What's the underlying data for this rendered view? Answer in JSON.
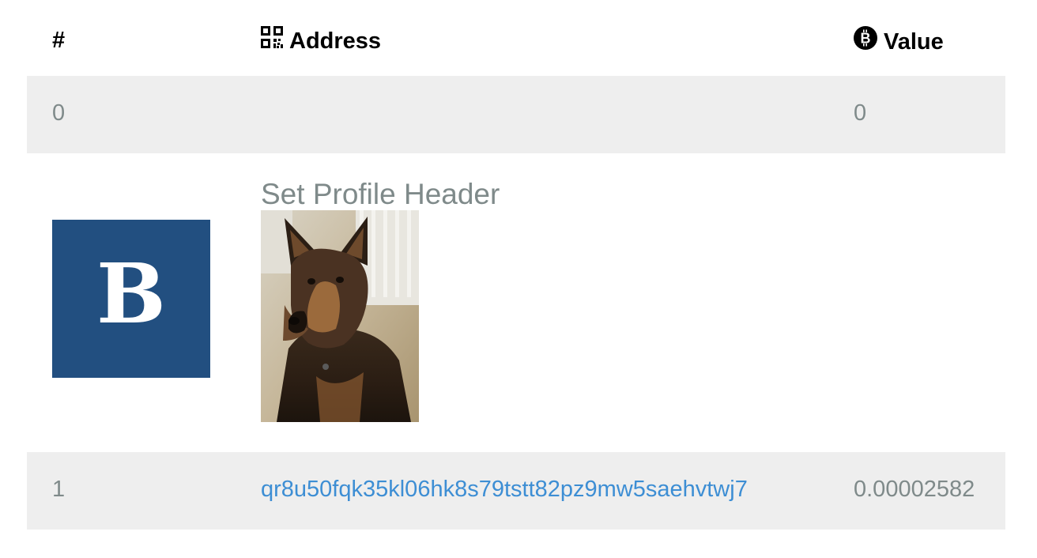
{
  "header": {
    "num_label": "#",
    "address_label": "Address",
    "value_label": "Value",
    "address_icon": "qr-code-icon",
    "value_icon": "bitcoin-icon"
  },
  "rows": [
    {
      "index": "0",
      "address": "",
      "value": "0"
    },
    {
      "index": "1",
      "address": "qr8u50fqk35kl06hk8s79tstt82pz9mw5saehvtwj7",
      "value": "0.00002582"
    }
  ],
  "op_return": {
    "logo_letter": "B",
    "logo_color": "#224f80",
    "title": "Set Profile Header",
    "image_subject": "german-shepherd-dog-photo"
  },
  "colors": {
    "row_shade": "#eeeeee",
    "link": "#3d8ed4",
    "muted_text": "#7f8a8a"
  }
}
